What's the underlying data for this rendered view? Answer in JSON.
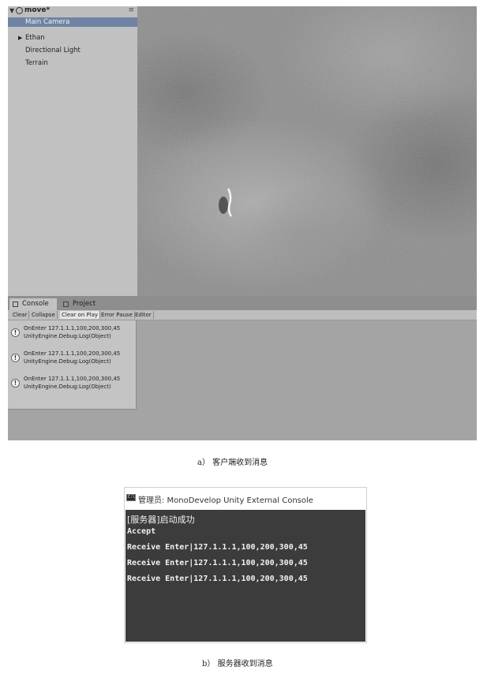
{
  "unity_editor": {
    "hierarchy": {
      "scene_name": "move*",
      "items": [
        {
          "label": "Main Camera",
          "selected": true,
          "expandable": false
        },
        {
          "label": "Ethan",
          "selected": false,
          "expandable": true
        },
        {
          "label": "Directional Light",
          "selected": false,
          "expandable": false
        },
        {
          "label": "Terrain",
          "selected": false,
          "expandable": false
        }
      ]
    },
    "tabs": [
      {
        "label": "Console",
        "icon": "console-icon",
        "active": true
      },
      {
        "label": "Project",
        "icon": "project-icon",
        "active": false
      }
    ],
    "toolbar": {
      "buttons": [
        {
          "label": "Clear",
          "on": false
        },
        {
          "label": "Collapse",
          "on": false
        },
        {
          "label": "Clear on Play",
          "on": true
        },
        {
          "label": "Error Pause",
          "on": false
        },
        {
          "label": "Editor",
          "on": false
        }
      ]
    },
    "log_entries": [
      {
        "line1": "OnEnter 127.1.1.1,100,200,300,45",
        "line2": "UnityEngine.Debug:Log(Object)",
        "icon": "info-icon"
      },
      {
        "line1": "OnEnter 127.1.1.1,100,200,300,45",
        "line2": "UnityEngine.Debug:Log(Object)",
        "icon": "info-icon"
      },
      {
        "line1": "OnEnter 127.1.1.1,100,200,300,45",
        "line2": "UnityEngine.Debug:Log(Object)",
        "icon": "info-icon"
      }
    ]
  },
  "caption_a": "a） 客户端收到消息",
  "console_window": {
    "title": "管理员: MonoDevelop Unity External Console",
    "lines": [
      "[服务器]启动成功",
      "Accept",
      "Receive Enter|127.1.1.1,100,200,300,45",
      "Receive Enter|127.1.1.1,100,200,300,45",
      "Receive Enter|127.1.1.1,100,200,300,45"
    ]
  },
  "caption_b": "b） 服务器收到消息",
  "colors": {
    "selection": "#6f84a4",
    "terminal_bg": "#3c3c3c",
    "terminal_text": "#f2f2f2"
  }
}
